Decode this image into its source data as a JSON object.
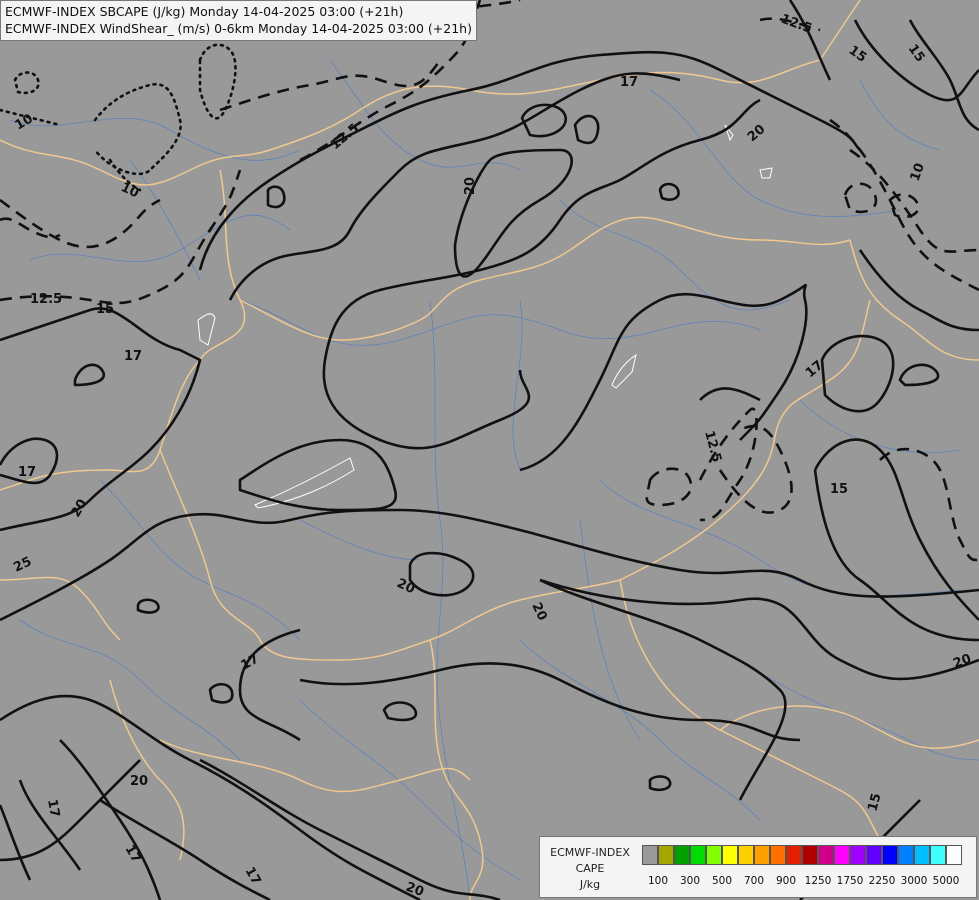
{
  "title": {
    "line1": "ECMWF-INDEX SBCAPE (J/kg) Monday 14-04-2025 03:00 (+21h)",
    "line2": "ECMWF-INDEX WindShear_ (m/s) 0-6km Monday 14-04-2025 03:00 (+21h)"
  },
  "legend": {
    "source": "ECMWF-INDEX",
    "field": "CAPE",
    "unit": "J/kg",
    "colors": [
      "#9a9a9a",
      "#a6a600",
      "#00a000",
      "#00dc00",
      "#80ff00",
      "#ffff00",
      "#ffd000",
      "#ffa000",
      "#ff7000",
      "#e02000",
      "#b00000",
      "#d0008a",
      "#ff00ff",
      "#a000ff",
      "#6000ff",
      "#0000ff",
      "#0080ff",
      "#00c0ff",
      "#40ffff",
      "#ffffff"
    ],
    "ticks": [
      "100",
      "300",
      "500",
      "700",
      "900",
      "1250",
      "1750",
      "2250",
      "3000",
      "5000"
    ]
  },
  "contour_labels": [
    {
      "text": "10"
    },
    {
      "text": "10"
    },
    {
      "text": "12.5"
    },
    {
      "text": "12.5"
    },
    {
      "text": "12.5"
    },
    {
      "text": "15"
    },
    {
      "text": "15"
    },
    {
      "text": "15"
    },
    {
      "text": "15"
    },
    {
      "text": "17"
    },
    {
      "text": "17"
    },
    {
      "text": "17"
    },
    {
      "text": "17"
    },
    {
      "text": "17"
    },
    {
      "text": "17"
    },
    {
      "text": "20"
    },
    {
      "text": "20"
    },
    {
      "text": "20"
    },
    {
      "text": "20"
    },
    {
      "text": "20"
    },
    {
      "text": "20"
    },
    {
      "text": "20"
    },
    {
      "text": "25"
    },
    {
      "text": "10"
    },
    {
      "text": "15"
    },
    {
      "text": "17"
    },
    {
      "text": "12.5"
    },
    {
      "text": "17"
    }
  ]
}
